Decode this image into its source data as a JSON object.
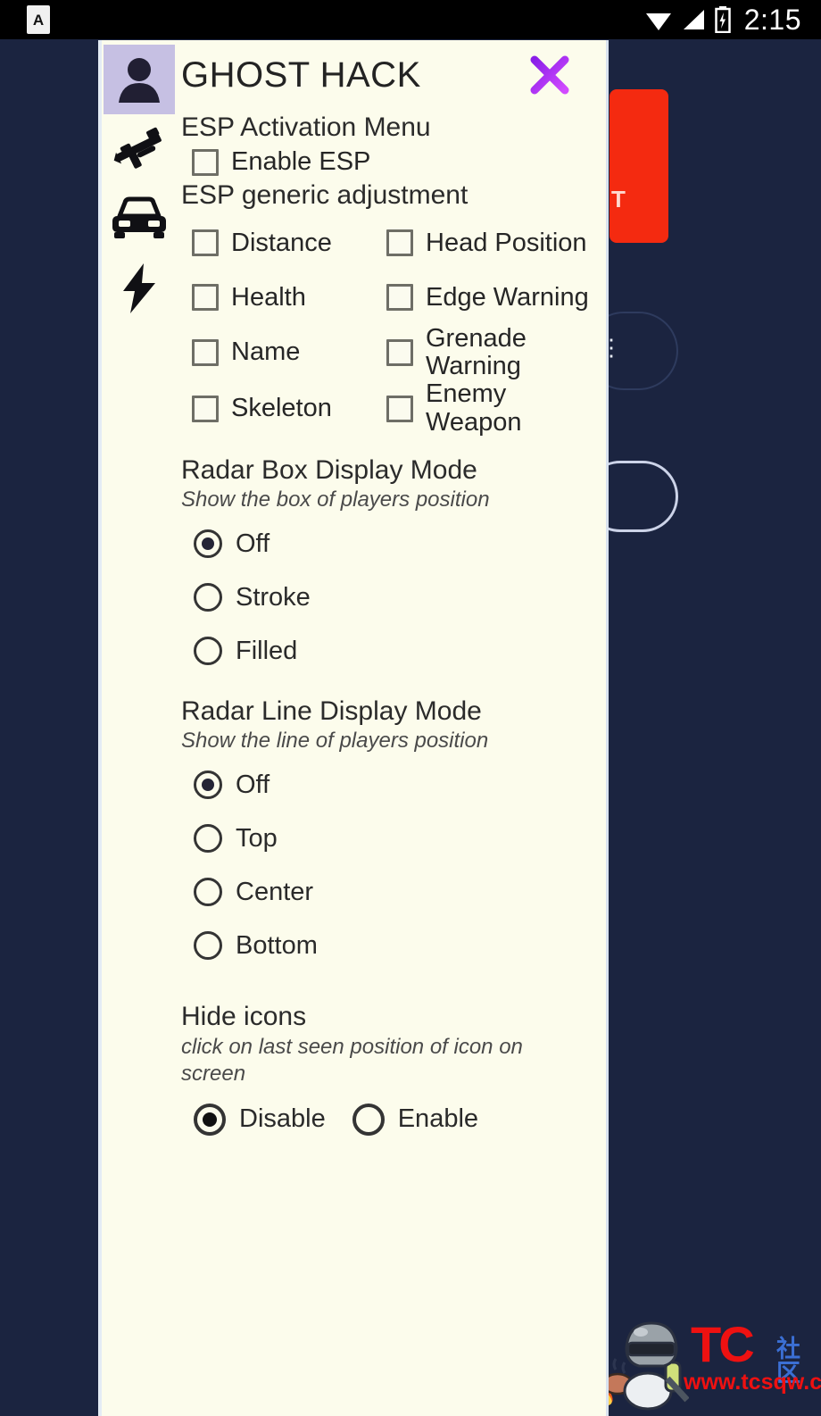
{
  "status_bar": {
    "app_icon_letter": "A",
    "clock": "2:15",
    "icons": [
      "wifi-icon",
      "signal-icon",
      "battery-charging-icon"
    ]
  },
  "background": {
    "red_button_label": "T",
    "pill_dots": "⋮"
  },
  "watermark": {
    "brand": "TC",
    "brand_cn": "社区",
    "url": "www.tcsqw.com",
    "brand_color": "#ee1111",
    "cn_color": "#3b6fd4"
  },
  "panel": {
    "title": "GHOST HACK",
    "close_label": "×",
    "accent_color": "#b42ef0",
    "background_color": "#fcfcec",
    "rail": [
      {
        "name": "person-icon",
        "label": "Player",
        "active": true
      },
      {
        "name": "rifle-icon",
        "label": "Weapon",
        "active": false
      },
      {
        "name": "car-icon",
        "label": "Vehicle",
        "active": false
      },
      {
        "name": "bolt-icon",
        "label": "Misc",
        "active": false
      }
    ],
    "esp_activation": {
      "heading": "ESP Activation Menu",
      "checkbox": {
        "label": "Enable ESP",
        "checked": false
      }
    },
    "esp_generic": {
      "heading": "ESP generic adjustment",
      "left_column": [
        {
          "label": "Distance",
          "checked": false
        },
        {
          "label": "Health",
          "checked": false
        },
        {
          "label": "Name",
          "checked": false
        },
        {
          "label": "Skeleton",
          "checked": false
        }
      ],
      "right_column": [
        {
          "label": "Head Position",
          "checked": false
        },
        {
          "label": "Edge Warning",
          "checked": false
        },
        {
          "label": "Grenade Warning",
          "checked": false
        },
        {
          "label": "Enemy Weapon",
          "checked": false
        }
      ]
    },
    "radar_box": {
      "heading": "Radar Box Display Mode",
      "subtitle": "Show the box of players position",
      "options": [
        {
          "label": "Off",
          "selected": true
        },
        {
          "label": "Stroke",
          "selected": false
        },
        {
          "label": "Filled",
          "selected": false
        }
      ]
    },
    "radar_line": {
      "heading": "Radar Line Display Mode",
      "subtitle": "Show the line of players position",
      "options": [
        {
          "label": "Off",
          "selected": true
        },
        {
          "label": "Top",
          "selected": false
        },
        {
          "label": "Center",
          "selected": false
        },
        {
          "label": "Bottom",
          "selected": false
        }
      ]
    },
    "hide_icons": {
      "heading": "Hide icons",
      "subtitle": "click on last seen position of icon on screen",
      "options": [
        {
          "label": "Disable",
          "selected": true
        },
        {
          "label": "Enable",
          "selected": false
        }
      ]
    }
  }
}
